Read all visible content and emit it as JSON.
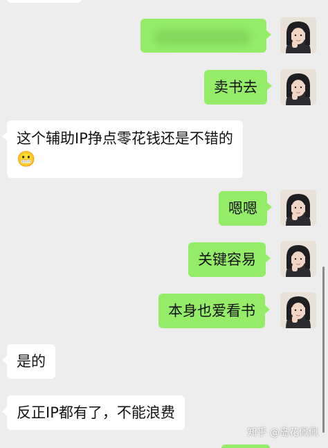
{
  "colors": {
    "background": "#ededed",
    "outgoing_bubble": "#95ec69",
    "incoming_bubble": "#ffffff",
    "text": "#111111"
  },
  "messages": [
    {
      "side": "out",
      "text": "",
      "blurred": true,
      "icon": "blurred-content"
    },
    {
      "side": "out",
      "text": "卖书去"
    },
    {
      "side": "in",
      "line1": "这个辅助IP挣点零花钱还是不错的",
      "emoji": "😬"
    },
    {
      "side": "out",
      "text": "嗯嗯"
    },
    {
      "side": "out",
      "text": "关键容易"
    },
    {
      "side": "out",
      "text": "本身也爱看书"
    },
    {
      "side": "in",
      "text": "是的"
    },
    {
      "side": "in",
      "text": "反正IP都有了，不能浪费"
    }
  ],
  "watermark": "知乎 @岛花佩佩"
}
